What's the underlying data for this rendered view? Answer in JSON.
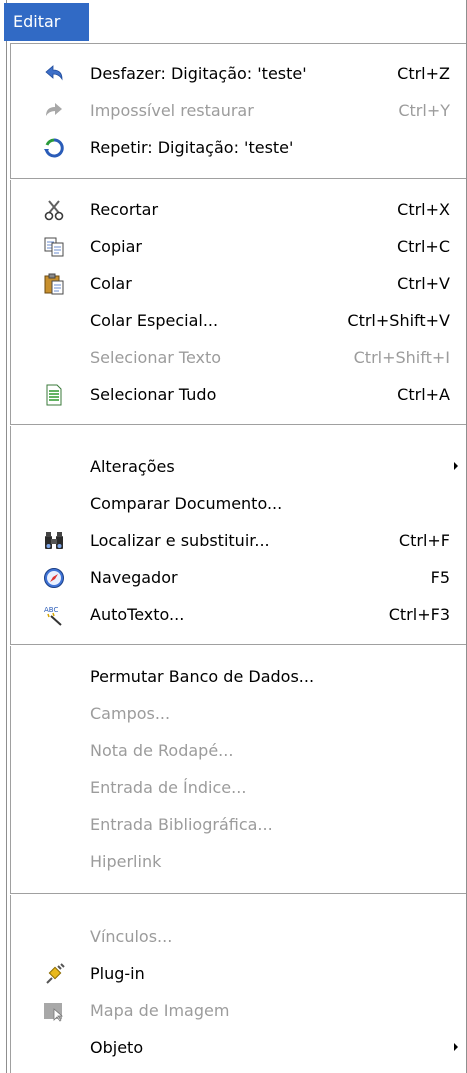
{
  "menu_title": "Editar",
  "items": [
    {
      "label": "Desfazer: Digitação: 'teste'",
      "shortcut": "Ctrl+Z",
      "icon": "undo-icon",
      "disabled": false
    },
    {
      "label": "Impossível restaurar",
      "shortcut": "Ctrl+Y",
      "icon": "redo-icon",
      "disabled": true
    },
    {
      "label": "Repetir: Digitação: 'teste'",
      "shortcut": "",
      "icon": "repeat-icon",
      "disabled": false
    },
    {
      "label": "Recortar",
      "shortcut": "Ctrl+X",
      "icon": "scissors-icon",
      "disabled": false
    },
    {
      "label": "Copiar",
      "shortcut": "Ctrl+C",
      "icon": "copy-icon",
      "disabled": false
    },
    {
      "label": "Colar",
      "shortcut": "Ctrl+V",
      "icon": "paste-icon",
      "disabled": false
    },
    {
      "label": "Colar Especial...",
      "shortcut": "Ctrl+Shift+V",
      "icon": "",
      "disabled": false
    },
    {
      "label": "Selecionar Texto",
      "shortcut": "Ctrl+Shift+I",
      "icon": "",
      "disabled": true
    },
    {
      "label": "Selecionar Tudo",
      "shortcut": "Ctrl+A",
      "icon": "select-all-icon",
      "disabled": false
    },
    {
      "label": "Alterações",
      "shortcut": "",
      "icon": "",
      "disabled": false
    },
    {
      "label": "Comparar Documento...",
      "shortcut": "",
      "icon": "",
      "disabled": false
    },
    {
      "label": "Localizar e substituir...",
      "shortcut": "Ctrl+F",
      "icon": "binoculars-icon",
      "disabled": false
    },
    {
      "label": "Navegador",
      "shortcut": "F5",
      "icon": "compass-icon",
      "disabled": false
    },
    {
      "label": "AutoTexto...",
      "shortcut": "Ctrl+F3",
      "icon": "autotext-icon",
      "disabled": false
    },
    {
      "label": "Permutar Banco de Dados...",
      "shortcut": "",
      "icon": "",
      "disabled": false
    },
    {
      "label": "Campos...",
      "shortcut": "",
      "icon": "",
      "disabled": true
    },
    {
      "label": "Nota de Rodapé...",
      "shortcut": "",
      "icon": "",
      "disabled": true
    },
    {
      "label": "Entrada de Índice...",
      "shortcut": "",
      "icon": "",
      "disabled": true
    },
    {
      "label": "Entrada Bibliográfica...",
      "shortcut": "",
      "icon": "",
      "disabled": true
    },
    {
      "label": "Hiperlink",
      "shortcut": "",
      "icon": "",
      "disabled": true
    },
    {
      "label": "Vínculos...",
      "shortcut": "",
      "icon": "",
      "disabled": true
    },
    {
      "label": "Plug-in",
      "shortcut": "",
      "icon": "plugin-icon",
      "disabled": false
    },
    {
      "label": "Mapa de Imagem",
      "shortcut": "",
      "icon": "image-map-icon",
      "disabled": true
    },
    {
      "label": "Objeto",
      "shortcut": "",
      "icon": "",
      "disabled": false
    }
  ],
  "colors": {
    "highlight": "#316ac5",
    "disabled_text": "#9c9c9c"
  }
}
